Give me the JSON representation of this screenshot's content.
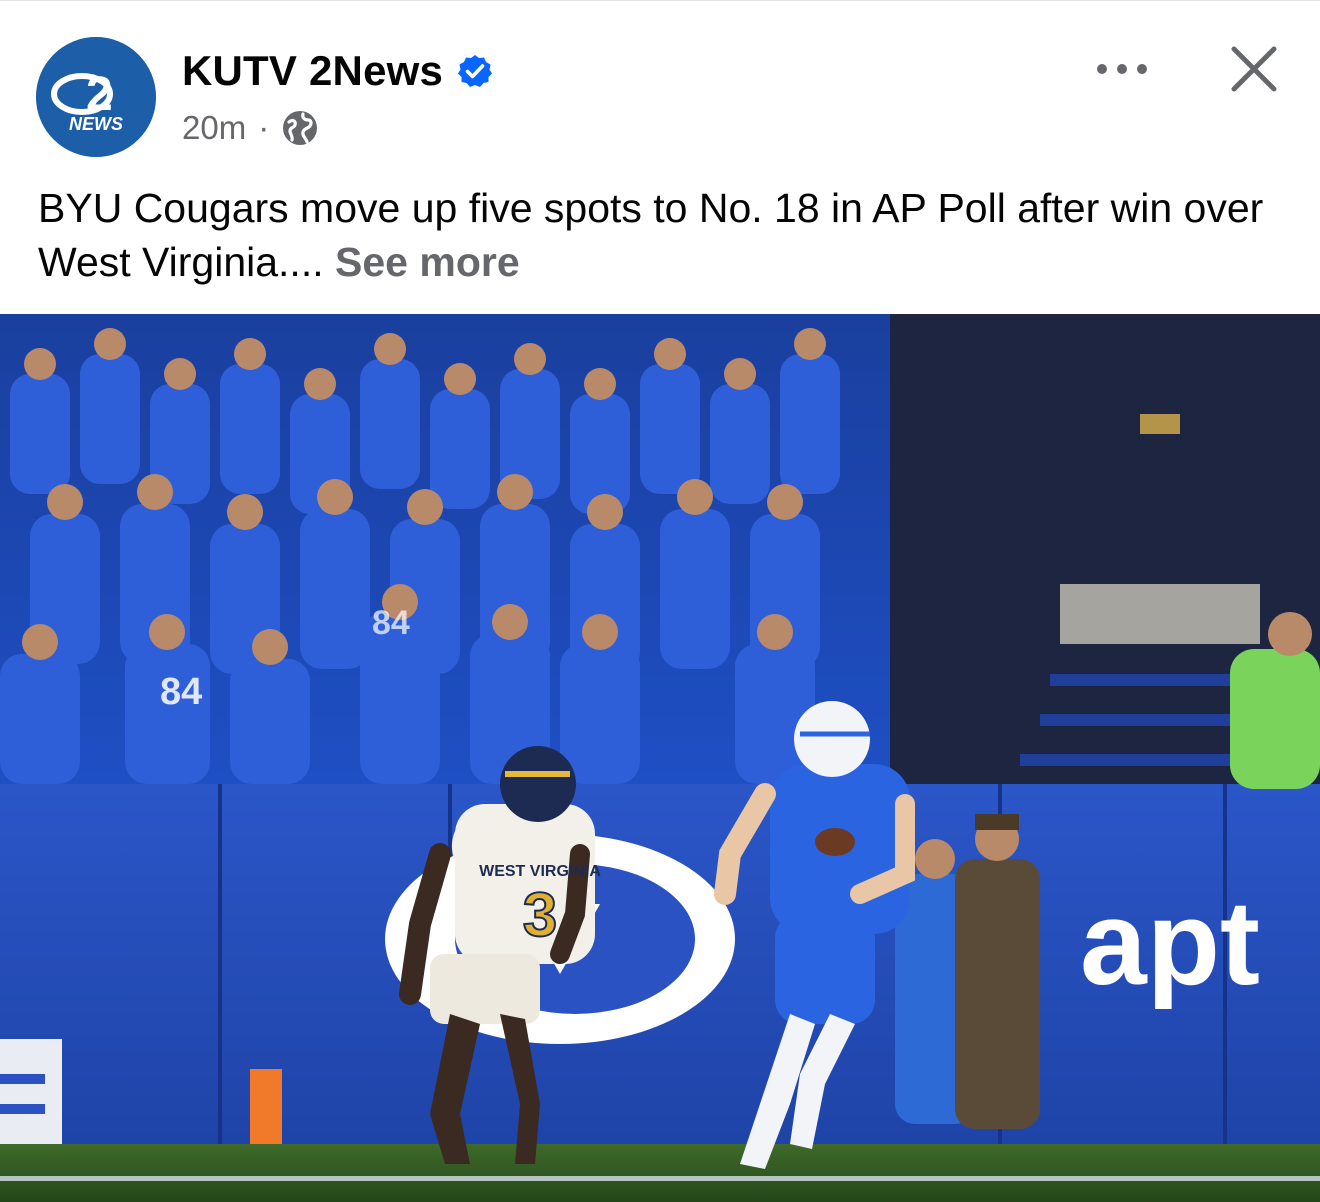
{
  "post": {
    "page_name": "KUTV 2News",
    "timestamp": "20m",
    "separator": "·",
    "privacy_icon": "globe-icon",
    "verified_icon": "verified-badge-icon",
    "more_icon": "more-options-icon",
    "close_icon": "close-icon",
    "caption": "BYU Cougars move up five spots to No. 18 in AP Poll after win over West Virginia....",
    "see_more": "See more"
  },
  "avatar": {
    "logo_number": "2",
    "logo_word": "NEWS"
  },
  "photo": {
    "description_icon": "football-photo",
    "jersey_wvu_wordmark": "WEST VIRGINIA",
    "jersey_wvu_number": "3",
    "sponsor_text": "apt",
    "crowd_jersey_number": "84"
  },
  "colors": {
    "brand_blue": "#1c5ea8",
    "verified_blue": "#0866ff",
    "secondary_text": "#65676b",
    "primary_text": "#050505"
  }
}
